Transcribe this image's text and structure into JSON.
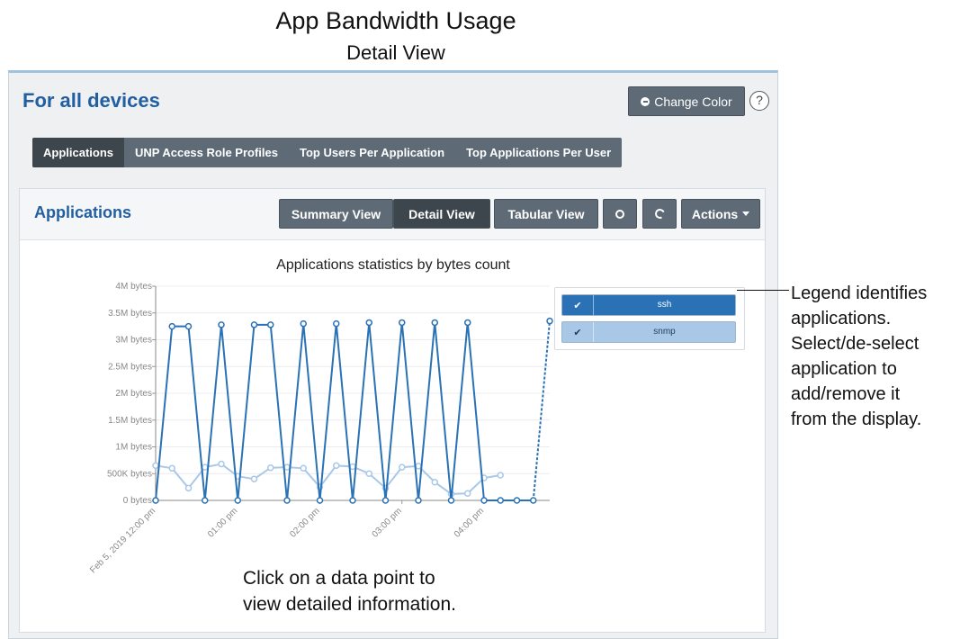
{
  "caption": {
    "title": "App Bandwidth Usage",
    "subtitle": "Detail View"
  },
  "header": {
    "title": "For all devices",
    "change_color_label": "Change Color",
    "help_label": "?"
  },
  "tabs": [
    {
      "label": "Applications",
      "active": true
    },
    {
      "label": "UNP Access Role Profiles",
      "active": false
    },
    {
      "label": "Top Users Per Application",
      "active": false
    },
    {
      "label": "Top Applications Per User",
      "active": false
    }
  ],
  "card": {
    "title": "Applications",
    "view_buttons": [
      {
        "label": "Summary View",
        "active": false
      },
      {
        "label": "Detail View",
        "active": true
      },
      {
        "label": "Tabular View",
        "active": false
      }
    ],
    "settings_icon": "gear-icon",
    "refresh_icon": "refresh-icon",
    "actions_label": "Actions"
  },
  "chart_data": {
    "type": "line",
    "title": "Applications statistics by bytes count",
    "ylim": [
      0,
      4000000
    ],
    "yticks": [
      "0 bytes",
      "500K bytes",
      "1M bytes",
      "1.5M bytes",
      "2M bytes",
      "2.5M bytes",
      "3M bytes",
      "3.5M bytes",
      "4M bytes"
    ],
    "xticks": [
      "Feb 5, 2019 12:00 pm",
      "01:00 pm",
      "02:00 pm",
      "03:00 pm",
      "04:00 pm"
    ],
    "x_minutes": [
      0,
      12,
      24,
      36,
      48,
      60,
      72,
      84,
      96,
      108,
      120,
      132,
      144,
      156,
      168,
      180,
      192,
      204,
      216,
      228,
      240,
      252,
      264,
      276,
      288
    ],
    "series": [
      {
        "name": "ssh",
        "color": "#2a72b5",
        "dashed_last": true,
        "values": [
          0,
          3250000,
          3250000,
          0,
          3280000,
          0,
          3280000,
          3280000,
          0,
          3300000,
          0,
          3300000,
          0,
          3320000,
          0,
          3320000,
          0,
          3320000,
          0,
          3320000,
          0,
          0,
          0,
          0,
          3350000
        ]
      },
      {
        "name": "snmp",
        "color": "#a9c8e8",
        "dashed_last": false,
        "values": [
          650000,
          600000,
          230000,
          620000,
          680000,
          450000,
          400000,
          610000,
          620000,
          600000,
          250000,
          650000,
          630000,
          500000,
          230000,
          620000,
          640000,
          340000,
          120000,
          130000,
          420000,
          470000
        ]
      }
    ]
  },
  "chart_note_lines": [
    "Click on a data point to",
    "view detailed information."
  ],
  "annotation_lines": [
    "Legend identifies",
    "applications.",
    "Select/de-select",
    "application to",
    "add/remove it",
    "from the display."
  ]
}
